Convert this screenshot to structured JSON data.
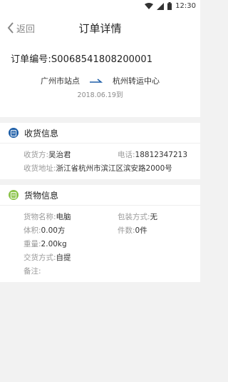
{
  "status_bar": {
    "time": "12:30"
  },
  "nav": {
    "back_label": "返回",
    "title": "订单详情"
  },
  "order": {
    "number_text": "订单编号:S0068541808200001",
    "from": "广州市站点",
    "to": "杭州转运中心",
    "arrival": "2018.06.19到"
  },
  "receiver": {
    "section_title": "收货信息",
    "name_key": "收货方:",
    "name": "吴治君",
    "phone_key": "电话:",
    "phone": "18812347213",
    "address_key": "收货地址:",
    "address": "浙江省杭州市滨江区滨安路2000号"
  },
  "cargo": {
    "section_title": "货物信息",
    "name_key": "货物名称:",
    "name": "电脑",
    "pack_key": "包装方式:",
    "pack": "无",
    "volume_key": "体积:",
    "volume": "0.00方",
    "count_key": "件数:",
    "count": "0件",
    "weight_key": "重量:",
    "weight": "2.00kg",
    "delivery_key": "交货方式:",
    "delivery": "自提",
    "remark_key": "备注:",
    "remark": ""
  },
  "colors": {
    "receiver_badge": "#1f5fa8",
    "cargo_badge": "#8bc34a"
  }
}
